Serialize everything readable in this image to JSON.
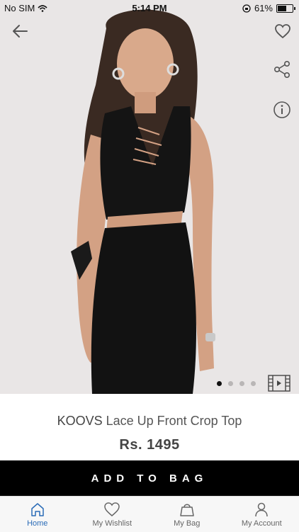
{
  "status_bar": {
    "carrier": "No SIM",
    "time": "5:14 PM",
    "battery": "61%",
    "battery_level": 0.61
  },
  "header": {
    "back_icon": "arrow-left-icon",
    "wishlist_icon": "heart-icon",
    "share_icon": "share-icon",
    "info_icon": "info-icon"
  },
  "gallery": {
    "image_count": 4,
    "active_index": 0,
    "video_icon": "film-icon"
  },
  "product": {
    "brand": "KOOVS",
    "name": "Lace Up Front Crop Top",
    "price": "Rs. 1495"
  },
  "actions": {
    "add_to_bag": "ADD TO BAG"
  },
  "tabs": [
    {
      "label": "Home",
      "icon": "home-icon",
      "active": true
    },
    {
      "label": "My Wishlist",
      "icon": "heart-icon",
      "active": false
    },
    {
      "label": "My Bag",
      "icon": "bag-icon",
      "active": false
    },
    {
      "label": "My Account",
      "icon": "user-icon",
      "active": false
    }
  ],
  "colors": {
    "accent": "#2a6bb7",
    "button_bg": "#000000",
    "photo_bg": "#e9e6e6"
  }
}
